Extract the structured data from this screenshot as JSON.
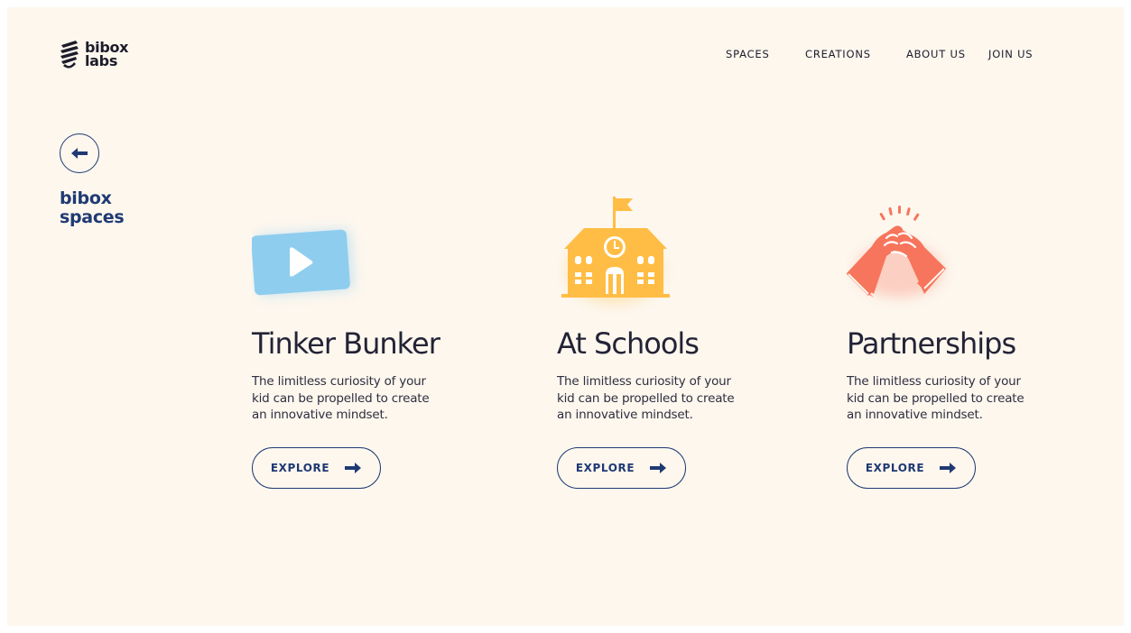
{
  "brand": {
    "line1": "bibox",
    "line2": "labs"
  },
  "nav": [
    {
      "label": "SPACES"
    },
    {
      "label": "CREATIONS"
    },
    {
      "label": "ABOUT US"
    },
    {
      "label": "JOIN US"
    }
  ],
  "section": {
    "line1": "bibox",
    "line2": "spaces"
  },
  "cards": [
    {
      "title": "Tinker Bunker",
      "description": "The limitless curiosity of your kid can be propelled to create an innovative mindset.",
      "button": "EXPLORE",
      "icon": "play-video-icon",
      "color": "#8ecdee"
    },
    {
      "title": "At Schools",
      "description": "The limitless curiosity of your kid can be propelled to create an innovative mindset.",
      "button": "EXPLORE",
      "icon": "school-building-icon",
      "color": "#ffbd45"
    },
    {
      "title": "Partnerships",
      "description": "The limitless curiosity of your kid can be propelled to create an innovative mindset.",
      "button": "EXPLORE",
      "icon": "high-five-icon",
      "color": "#f7755c"
    }
  ],
  "colors": {
    "background": "#fdf7ee",
    "accent": "#1f3a73",
    "text": "#232336"
  }
}
